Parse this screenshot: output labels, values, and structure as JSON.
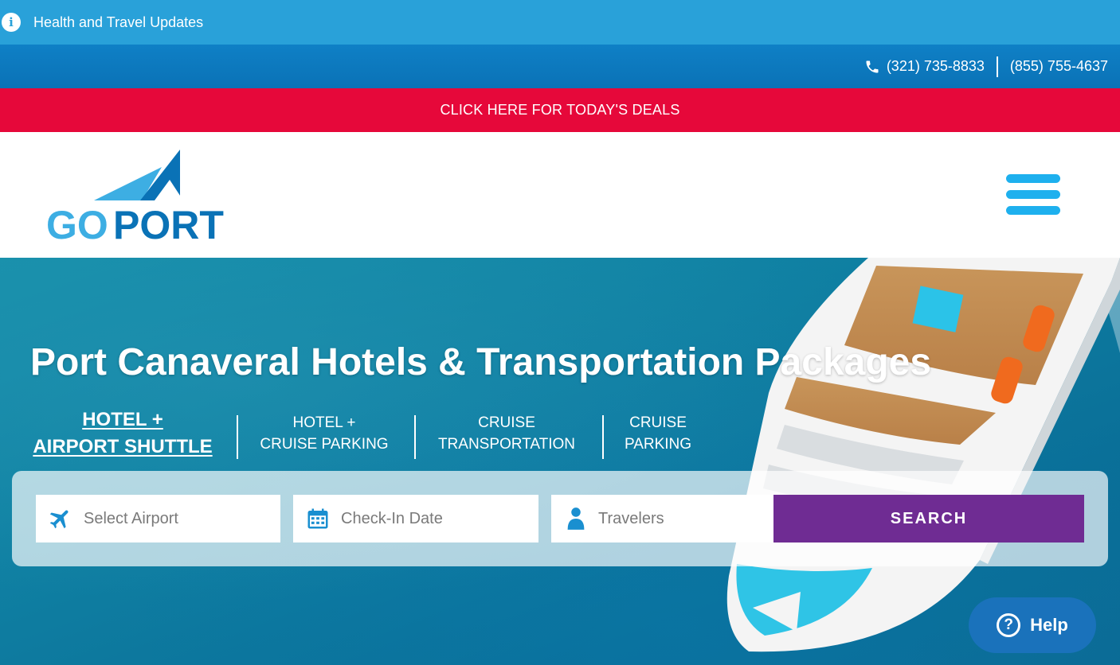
{
  "info_bar": {
    "text": "Health and Travel Updates",
    "icon": "info-icon"
  },
  "phone_bar": {
    "icon": "phone-icon",
    "phone1": "(321) 735-8833",
    "phone2": "(855) 755-4637"
  },
  "deals_bar": {
    "text": "CLICK HERE FOR TODAY'S DEALS"
  },
  "header": {
    "logo": {
      "part1": "GO",
      "part2": "PORT",
      "colors": {
        "go": "#3daee3",
        "port": "#0a72b6"
      }
    },
    "menu_icon": "hamburger-menu-icon"
  },
  "hero": {
    "title": "Port Canaveral Hotels & Transportation Packages",
    "tabs": [
      {
        "line1": "HOTEL +",
        "line2": "AIRPORT SHUTTLE",
        "active": true
      },
      {
        "line1": "HOTEL +",
        "line2": "CRUISE PARKING",
        "active": false
      },
      {
        "line1": "CRUISE",
        "line2": "TRANSPORTATION",
        "active": false
      },
      {
        "line1": "CRUISE",
        "line2": "PARKING",
        "active": false
      }
    ],
    "search": {
      "airport_placeholder": "Select Airport",
      "checkin_placeholder": "Check-In Date",
      "travelers_placeholder": "Travelers",
      "button_label": "SEARCH",
      "icons": [
        "airplane-icon",
        "calendar-icon",
        "person-icon"
      ]
    }
  },
  "help": {
    "label": "Help",
    "icon": "question-icon"
  },
  "colors": {
    "info_bar": "#29a1d9",
    "phone_bar": "#0a72b6",
    "deals_bar": "#e6083a",
    "search_button": "#6f2c93",
    "help_button": "#1a72bb",
    "menu": "#1eb0ee"
  }
}
